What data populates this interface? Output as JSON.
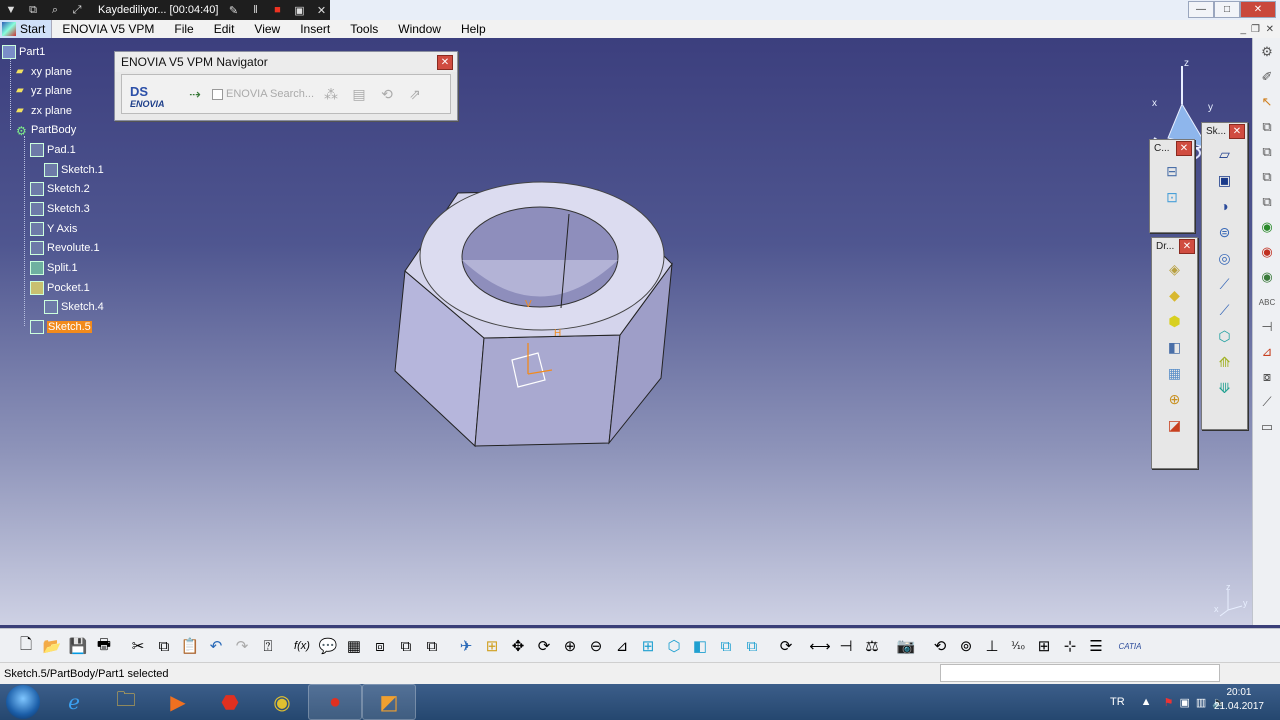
{
  "recorder": {
    "status": "Kaydediliyor... [00:04:40]",
    "icons": [
      "menu-triangle-icon",
      "window-icon",
      "magnifier-icon",
      "resize-icon",
      "pencil-icon",
      "pause-icon",
      "record-stop-icon",
      "camera-icon",
      "close-icon"
    ]
  },
  "menu": {
    "start": "Start",
    "items": [
      "ENOVIA V5 VPM",
      "File",
      "Edit",
      "View",
      "Insert",
      "Tools",
      "Window",
      "Help"
    ]
  },
  "tree": {
    "root": "Part1",
    "nodes": [
      {
        "label": "xy plane",
        "icon": "plane-icon",
        "depth": 1
      },
      {
        "label": "yz plane",
        "icon": "plane-icon",
        "depth": 1
      },
      {
        "label": "zx plane",
        "icon": "plane-icon",
        "depth": 1
      },
      {
        "label": "PartBody",
        "icon": "body-icon",
        "depth": 1
      },
      {
        "label": "Pad.1",
        "icon": "pad-icon",
        "depth": 2
      },
      {
        "label": "Sketch.1",
        "icon": "sketch-icon",
        "depth": 3
      },
      {
        "label": "Sketch.2",
        "icon": "sketch-icon",
        "depth": 2
      },
      {
        "label": "Sketch.3",
        "icon": "sketch-icon",
        "depth": 2
      },
      {
        "label": "Y Axis",
        "icon": "sketch-icon",
        "depth": 2
      },
      {
        "label": "Revolute.1",
        "icon": "sketch-icon",
        "depth": 2
      },
      {
        "label": "Split.1",
        "icon": "split-icon",
        "depth": 2
      },
      {
        "label": "Pocket.1",
        "icon": "pocket-icon",
        "depth": 2
      },
      {
        "label": "Sketch.4",
        "icon": "sketch-icon",
        "depth": 3
      },
      {
        "label": "Sketch.5",
        "icon": "sketch-icon",
        "depth": 2,
        "selected": true
      }
    ]
  },
  "enovia": {
    "title": "ENOVIA V5 VPM Navigator",
    "logo_ds": "DS",
    "logo_text": "ENOVIA",
    "search_label": "ENOVIA Search..."
  },
  "floating": {
    "c_title": "C...",
    "dr_title": "Dr...",
    "sk_title": "Sk..."
  },
  "viewport": {
    "axis_h": "H",
    "axis_v": "V",
    "compass_x": "x",
    "compass_y": "y",
    "compass_z": "z",
    "corner_y": "y",
    "corner_x": "x",
    "corner_z": "z"
  },
  "right_strip": {
    "abc_label": "ABC"
  },
  "bottom_toolbar": {
    "fx_label": "f(x)",
    "catia_label": "CATIA"
  },
  "status": {
    "text": "Sketch.5/PartBody/Part1 selected"
  },
  "tray": {
    "lang": "TR",
    "time": "20:01",
    "date": "21.04.2017"
  },
  "colors": {
    "viewport_top": "#3c3f7e",
    "viewport_bottom": "#ced1e4",
    "selection": "#f28a1c",
    "nut_face": "#c8c8e6"
  }
}
